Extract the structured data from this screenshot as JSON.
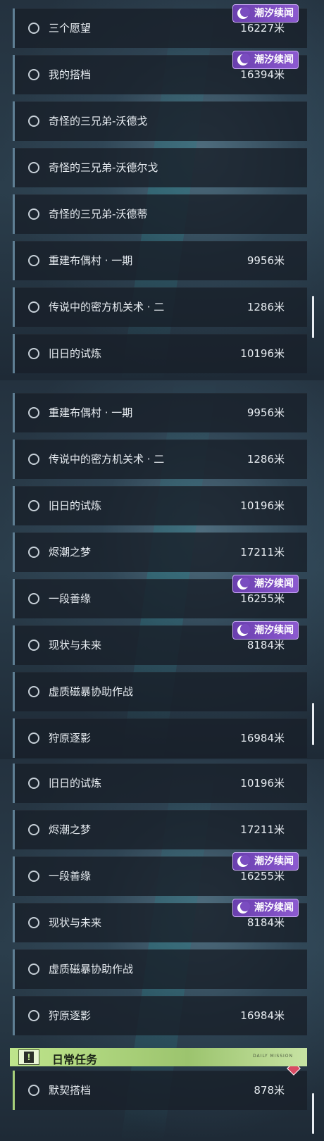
{
  "distance_unit": "米",
  "tag_label": "潮汐续闻",
  "daily_header": {
    "title": "日常任务",
    "subtitle": "DAILY MISSION"
  },
  "panel1": {
    "items": [
      {
        "label": "三个愿望",
        "distance": "16227米",
        "tag": true
      },
      {
        "label": "我的搭档",
        "distance": "16394米",
        "tag": true
      },
      {
        "label": "奇怪的三兄弟-沃德戈",
        "distance": "",
        "tag": false
      },
      {
        "label": "奇怪的三兄弟-沃德尔戈",
        "distance": "",
        "tag": false
      },
      {
        "label": "奇怪的三兄弟-沃德蒂",
        "distance": "",
        "tag": false
      },
      {
        "label": "重建布偶村 · 一期",
        "distance": "9956米",
        "tag": false
      },
      {
        "label": "传说中的密方机关术 · 二",
        "distance": "1286米",
        "tag": false
      },
      {
        "label": "旧日的试炼",
        "distance": "10196米",
        "tag": false
      }
    ]
  },
  "panel2": {
    "items": [
      {
        "label": "重建布偶村 · 一期",
        "distance": "9956米",
        "tag": false
      },
      {
        "label": "传说中的密方机关术 · 二",
        "distance": "1286米",
        "tag": false
      },
      {
        "label": "旧日的试炼",
        "distance": "10196米",
        "tag": false
      },
      {
        "label": "烬潮之梦",
        "distance": "17211米",
        "tag": false
      },
      {
        "label": "一段善缘",
        "distance": "16255米",
        "tag": true
      },
      {
        "label": "现状与未来",
        "distance": "8184米",
        "tag": true
      },
      {
        "label": "虚质磁暴协助作战",
        "distance": "",
        "tag": false
      },
      {
        "label": "狩原逐影",
        "distance": "16984米",
        "tag": false
      }
    ]
  },
  "panel3": {
    "items": [
      {
        "label": "旧日的试炼",
        "distance": "10196米",
        "tag": false
      },
      {
        "label": "烬潮之梦",
        "distance": "17211米",
        "tag": false
      },
      {
        "label": "一段善缘",
        "distance": "16255米",
        "tag": true
      },
      {
        "label": "现状与未来",
        "distance": "8184米",
        "tag": true
      },
      {
        "label": "虚质磁暴协助作战",
        "distance": "",
        "tag": false
      },
      {
        "label": "狩原逐影",
        "distance": "16984米",
        "tag": false
      }
    ],
    "daily_items": [
      {
        "label": "默契搭档",
        "distance": "878米",
        "tag": false
      }
    ]
  },
  "colors": {
    "accent_daily": "#a8d07a",
    "tag_purple": "#7b4cc2",
    "row_bar": "#5f7f94"
  }
}
